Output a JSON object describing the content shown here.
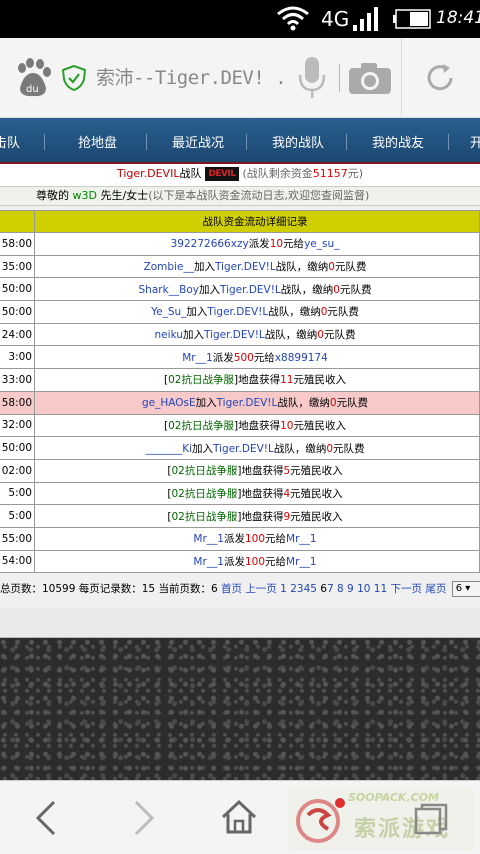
{
  "status_bar": {
    "network": "4G",
    "time": "18:41"
  },
  "browser": {
    "url_text": "索沛--Tiger.DEV! ...",
    "bottom_watermark_url": "SOOPACK.COM",
    "bottom_watermark_name": "索派游戏"
  },
  "nav": {
    "items": [
      "击队",
      "抢地盘",
      "最近战况",
      "我的战队",
      "我的战友",
      "开"
    ]
  },
  "team": {
    "name": "Tiger.DEVIL",
    "label": "战队",
    "logo_text": "DEVIL",
    "funds_prefix": "(战队剩余资金",
    "funds_value": "51157",
    "funds_suffix": "元)"
  },
  "greeting": {
    "prefix": "尊敬的",
    "user": "w3D",
    "honorific": "先生/女士",
    "note": "(以下是本战队资金流动日志,欢迎您查阅监督)"
  },
  "table": {
    "header": "战队资金流动详细记录",
    "rows": [
      {
        "time": "58:00",
        "a": "392272666xzy",
        "b": "派发",
        "c": "10",
        "d": "元给",
        "e": "ye_su_",
        "f": ""
      },
      {
        "time": "35:00",
        "a": "Zombie__",
        "b": "加入",
        "c": "Tiger.DEV!L",
        "d": "战队，缴纳",
        "e": "0",
        "f": "元队费"
      },
      {
        "time": "50:00",
        "a": "Shark__Boy",
        "b": "加入",
        "c": "Tiger.DEV!L",
        "d": "战队，缴纳",
        "e": "0",
        "f": "元队费"
      },
      {
        "time": "50:00",
        "a": "Ye_Su_",
        "b": "加入",
        "c": "Tiger.DEV!L",
        "d": "战队，缴纳",
        "e": "0",
        "f": "元队费"
      },
      {
        "time": "24:00",
        "a": "neiku",
        "b": "加入",
        "c": "Tiger.DEV!L",
        "d": "战队，缴纳",
        "e": "0",
        "f": "元队费"
      },
      {
        "time": "3:00",
        "a": "Mr__1",
        "b": "派发",
        "c": "500",
        "d": "元给",
        "e": "x8899174",
        "f": ""
      },
      {
        "time": "33:00",
        "a": "[",
        "b": "02抗日战争服",
        "c": "]地盘获得",
        "d": "11",
        "e": "元殖民收入",
        "f": ""
      },
      {
        "time": "58:00",
        "a": "ge_HAOsE",
        "b": "加入",
        "c": "Tiger.DEV!L",
        "d": "战队，缴纳",
        "e": "0",
        "f": "元队费"
      },
      {
        "time": "32:00",
        "a": "[",
        "b": "02抗日战争服",
        "c": "]地盘获得",
        "d": "10",
        "e": "元殖民收入",
        "f": ""
      },
      {
        "time": "50:00",
        "a": "_______Ki",
        "b": "加入",
        "c": "Tiger.DEV!L",
        "d": "战队，缴纳",
        "e": "0",
        "f": "元队费"
      },
      {
        "time": "02:00",
        "a": "[",
        "b": "02抗日战争服",
        "c": "]地盘获得",
        "d": "5",
        "e": "元殖民收入",
        "f": ""
      },
      {
        "time": "5:00",
        "a": "[",
        "b": "02抗日战争服",
        "c": "]地盘获得",
        "d": "4",
        "e": "元殖民收入",
        "f": ""
      },
      {
        "time": "5:00",
        "a": "[",
        "b": "02抗日战争服",
        "c": "]地盘获得",
        "d": "9",
        "e": "元殖民收入",
        "f": ""
      },
      {
        "time": "55:00",
        "a": "Mr__1",
        "b": "派发",
        "c": "100",
        "d": "元给",
        "e": "Mr__1",
        "f": ""
      },
      {
        "time": "54:00",
        "a": "Mr__1",
        "b": "派发",
        "c": "100",
        "d": "元给",
        "e": "Mr__1",
        "f": ""
      }
    ]
  },
  "pager": {
    "summary": "总页数：10599 每页记录数：15 当前页数：6",
    "first": "首页",
    "prev": "上一页",
    "pages": [
      "1",
      "2",
      "3",
      "4",
      "5"
    ],
    "current": "6",
    "pages_after": [
      "7",
      "8",
      "9",
      "10",
      "11"
    ],
    "next": "下一页",
    "last": "尾页",
    "select_value": "6"
  }
}
